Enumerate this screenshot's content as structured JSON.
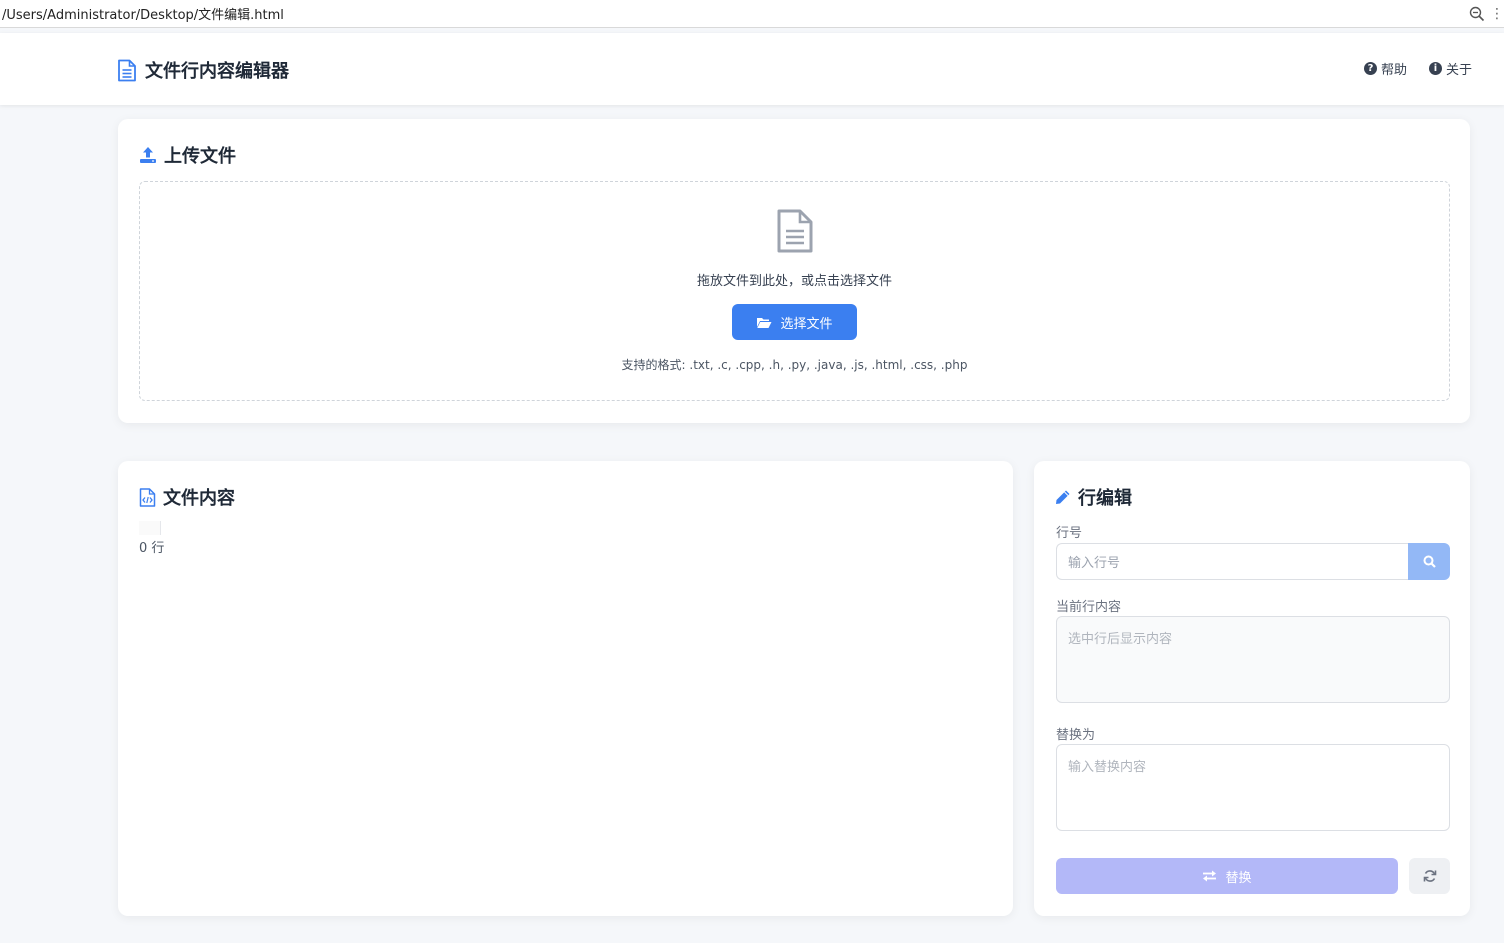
{
  "browser": {
    "url": "/Users/Administrator/Desktop/文件编辑.html"
  },
  "header": {
    "title": "文件行内容编辑器",
    "nav": [
      {
        "label": "帮助",
        "icon": "question-circle-icon"
      },
      {
        "label": "关于",
        "icon": "info-circle-icon"
      }
    ]
  },
  "upload": {
    "title": "上传文件",
    "drop_text": "拖放文件到此处，或点击选择文件",
    "choose_label": "选择文件",
    "formats": "支持的格式: .txt, .c, .cpp, .h, .py, .java, .js, .html, .css, .php"
  },
  "content": {
    "title": "文件内容",
    "line_count": "0 行"
  },
  "editor": {
    "title": "行编辑",
    "line_label": "行号",
    "line_placeholder": "输入行号",
    "current_label": "当前行内容",
    "current_placeholder": "选中行后显示内容",
    "replace_label": "替换为",
    "replace_placeholder": "输入替换内容",
    "replace_button": "替换"
  },
  "colors": {
    "accent": "#3b7ff0",
    "search_button": "#93b8f6",
    "replace_button": "#b3b8f8",
    "background": "#f5f7fa"
  }
}
